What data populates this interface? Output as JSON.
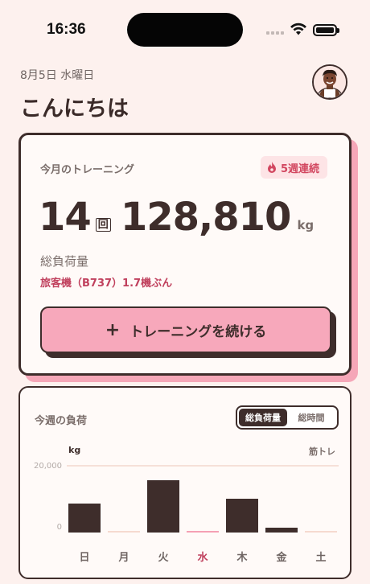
{
  "status_bar": {
    "time": "16:36"
  },
  "header": {
    "date": "8月5日 水曜日",
    "greeting": "こんにちは"
  },
  "monthly": {
    "title": "今月のトレーニング",
    "streak": "5週連続",
    "count_value": "14",
    "count_unit": "回",
    "load_value": "128,810",
    "load_unit": "kg",
    "load_label": "総負荷量",
    "comparison": "旅客機（B737）1.7機ぶん",
    "cta_icon": "+",
    "cta_label": "トレーニングを続ける"
  },
  "weekly": {
    "title": "今週の負荷",
    "tabs": [
      "総負荷量",
      "総時間"
    ],
    "active_tab": "総負荷量",
    "unit": "kg",
    "category": "筋トレ",
    "ticks": [
      "20,000",
      "0"
    ]
  },
  "chart_data": {
    "type": "bar",
    "categories": [
      "日",
      "月",
      "火",
      "水",
      "木",
      "金",
      "土"
    ],
    "values": [
      8600,
      0,
      15500,
      0,
      10000,
      1500,
      0
    ],
    "ylim": [
      0,
      20000
    ],
    "today": "水",
    "colors": {
      "bar": "#3e2d2b",
      "empty": "#f6dad0",
      "today_empty": "#f5a0b4"
    }
  },
  "colors": {
    "accent": "#f7a8bb",
    "text": "#3e2d2b",
    "background": "#fdf1ee",
    "streak": "#d24760"
  }
}
